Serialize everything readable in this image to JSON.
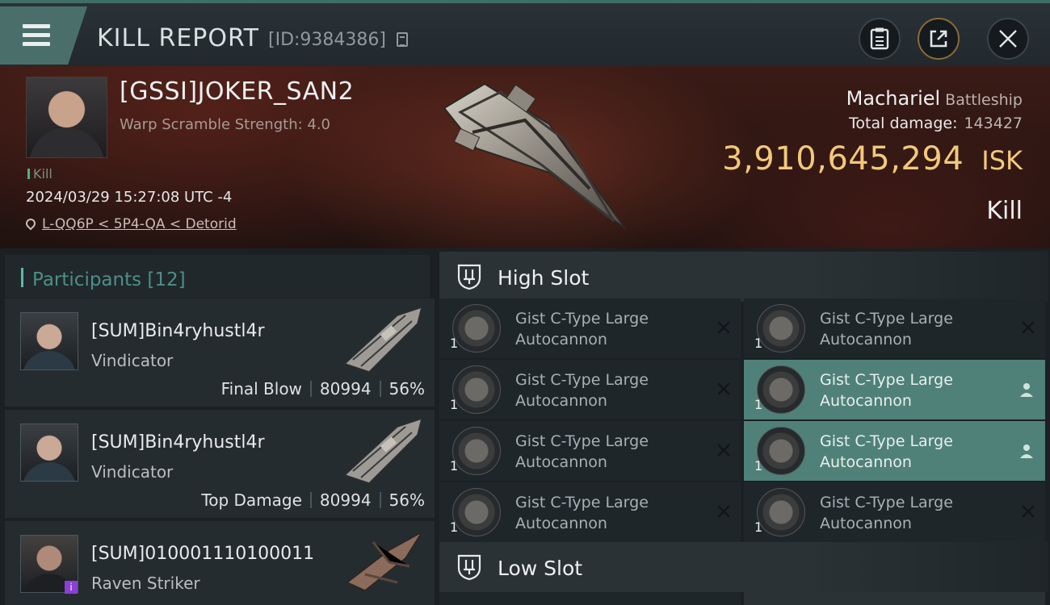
{
  "header": {
    "title": "KILL REPORT",
    "report_id": "[ID:9384386]"
  },
  "victim": {
    "name": "[GSSI]JOKER_SAN2",
    "subtitle": "Warp Scramble Strength: 4.0",
    "tag": "Kill",
    "timestamp": "2024/03/29 15:27:08 UTC -4",
    "location": "L-QQ6P < 5P4-QA < Detorid",
    "ship_name": "Machariel",
    "ship_class": "Battleship",
    "total_damage_label": "Total damage:",
    "total_damage": "143427",
    "isk_value": "3,910,645,294",
    "isk_unit": "ISK",
    "result": "Kill"
  },
  "participants": {
    "label": "Participants",
    "count": "[12]",
    "rows": [
      {
        "name": "[SUM]Bin4ryhustl4r",
        "ship": "Vindicator",
        "role": "Final Blow",
        "damage": "80994",
        "percent": "56%"
      },
      {
        "name": "[SUM]Bin4ryhustl4r",
        "ship": "Vindicator",
        "role": "Top Damage",
        "damage": "80994",
        "percent": "56%"
      },
      {
        "name": "[SUM]010001110100011",
        "ship": "Raven Striker",
        "badge": "i"
      }
    ]
  },
  "fitting": {
    "high_slot_label": "High Slot",
    "low_slot_label": "Low Slot",
    "modules": [
      {
        "name": "Gist C-Type Large Autocannon",
        "qty": "1"
      },
      {
        "name": "Gist C-Type Large Autocannon",
        "qty": "1"
      },
      {
        "name": "Gist C-Type Large Autocannon",
        "qty": "1"
      },
      {
        "name": "Gist C-Type Large Autocannon",
        "qty": "1"
      },
      {
        "name": "Gist C-Type Large Autocannon",
        "qty": "1"
      },
      {
        "name": "Gist C-Type Large Autocannon",
        "qty": "1"
      },
      {
        "name": "Gist C-Type Large Autocannon",
        "qty": "1"
      },
      {
        "name": "Gist C-Type Large Autocannon",
        "qty": "1"
      }
    ]
  },
  "colors": {
    "accent_teal": "#4f8178",
    "isk_gold": "#f1c97a",
    "participants_label": "#4d8f88"
  }
}
